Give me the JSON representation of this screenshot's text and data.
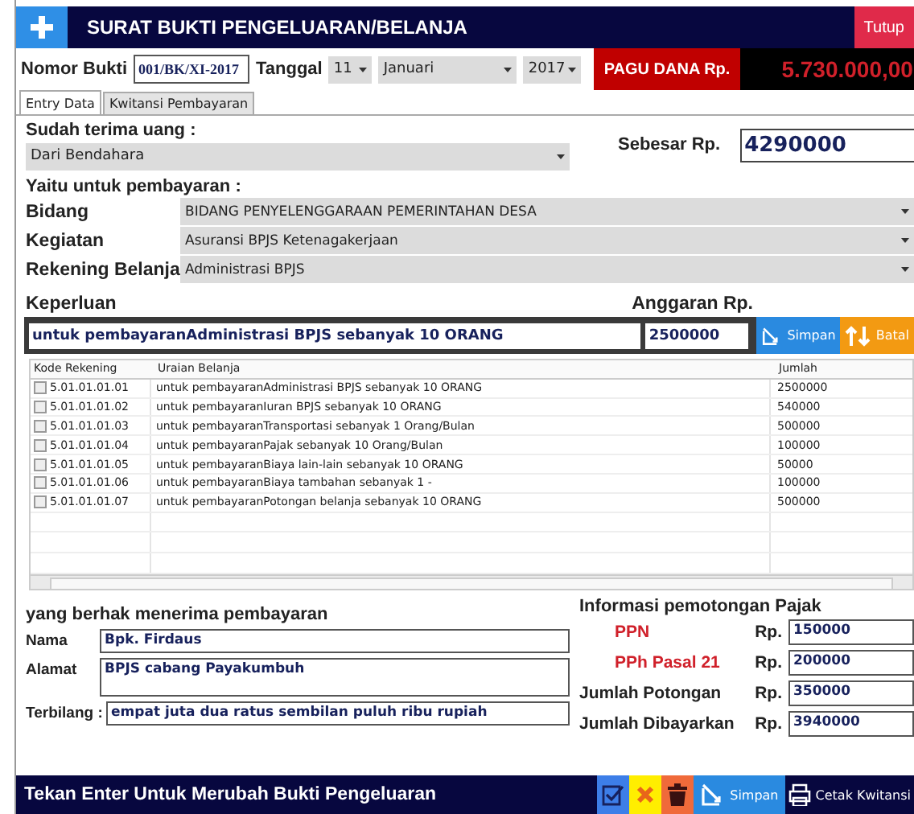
{
  "window": {
    "title": "SURAT BUKTI PENGELUARAN/BELANJA",
    "close": "Tutup"
  },
  "header": {
    "nomor_label": "Nomor Bukti",
    "nomor": "001/BK/XI-2017",
    "tanggal_label": "Tanggal",
    "day": "11",
    "month": "Januari",
    "year": "2017",
    "pagu_label": "PAGU DANA Rp.",
    "pagu": "5.730.000,00"
  },
  "tabs": [
    {
      "label": "Entry Data",
      "selected": true
    },
    {
      "label": "Kwitansi Pembayaran",
      "selected": false
    }
  ],
  "terima": {
    "label": "Sudah terima uang :",
    "value": "Dari Bendahara",
    "sebesar_label": "Sebesar Rp.",
    "sebesar": "4290000"
  },
  "pembayaran": {
    "label": "Yaitu untuk pembayaran :",
    "fields": [
      {
        "label": "Bidang",
        "value": "BIDANG PENYELENGGARAAN PEMERINTAHAN DESA"
      },
      {
        "label": "Kegiatan",
        "value": "Asuransi BPJS Ketenagakerjaan"
      },
      {
        "label": "Rekening Belanja",
        "value": "Administrasi BPJS"
      }
    ]
  },
  "entry": {
    "keperluan_label": "Keperluan",
    "anggaran_label": "Anggaran Rp.",
    "keperluan": "untuk pembayaranAdministrasi BPJS sebanyak 10 ORANG",
    "anggaran": "2500000",
    "save": "Simpan",
    "cancel": "Batal"
  },
  "table": {
    "columns": [
      "Kode Rekening",
      "Uraian Belanja",
      "Jumlah"
    ],
    "rows": [
      {
        "kode": "5.01.01.01.01",
        "uraian": "untuk pembayaranAdministrasi BPJS sebanyak 10 ORANG",
        "jumlah": "2500000",
        "checked": false
      },
      {
        "kode": "5.01.01.01.02",
        "uraian": "untuk pembayaranIuran BPJS sebanyak 10 ORANG",
        "jumlah": "540000",
        "checked": false
      },
      {
        "kode": "5.01.01.01.03",
        "uraian": "untuk pembayaranTransportasi sebanyak 1 Orang/Bulan",
        "jumlah": "500000",
        "checked": false
      },
      {
        "kode": "5.01.01.01.04",
        "uraian": "untuk pembayaranPajak sebanyak 10 Orang/Bulan",
        "jumlah": "100000",
        "checked": false
      },
      {
        "kode": "5.01.01.01.05",
        "uraian": "untuk pembayaranBiaya lain-lain sebanyak 10 ORANG",
        "jumlah": "50000",
        "checked": false
      },
      {
        "kode": "5.01.01.01.06",
        "uraian": "untuk pembayaranBiaya tambahan sebanyak 1 -",
        "jumlah": "100000",
        "checked": false
      },
      {
        "kode": "5.01.01.01.07",
        "uraian": "untuk pembayaranPotongan belanja sebanyak 10 ORANG",
        "jumlah": "500000",
        "checked": false
      }
    ]
  },
  "penerima": {
    "title": "yang berhak menerima pembayaran",
    "fields": [
      {
        "label": "Nama",
        "value": "Bpk. Firdaus"
      },
      {
        "label": "Alamat",
        "value": "BPJS cabang Payakumbuh"
      },
      {
        "label": "Terbilang :",
        "value": "empat juta dua ratus sembilan puluh  ribu rupiah"
      }
    ]
  },
  "pajak": {
    "title": "Informasi pemotongan Pajak",
    "rows": [
      {
        "label": "PPN",
        "kind": "tax",
        "currency": "Rp.",
        "value": "150000"
      },
      {
        "label": "PPh Pasal 21",
        "kind": "tax",
        "currency": "Rp.",
        "value": "200000"
      },
      {
        "label": "Jumlah Potongan",
        "kind": "total",
        "currency": "Rp.",
        "value": "350000"
      },
      {
        "label": "Jumlah Dibayarkan",
        "kind": "total",
        "currency": "Rp.",
        "value": "3940000"
      }
    ]
  },
  "footer": {
    "hint": "Tekan Enter Untuk Merubah Bukti Pengeluaran",
    "save": "Simpan",
    "print": "Cetak Kwitansi"
  }
}
